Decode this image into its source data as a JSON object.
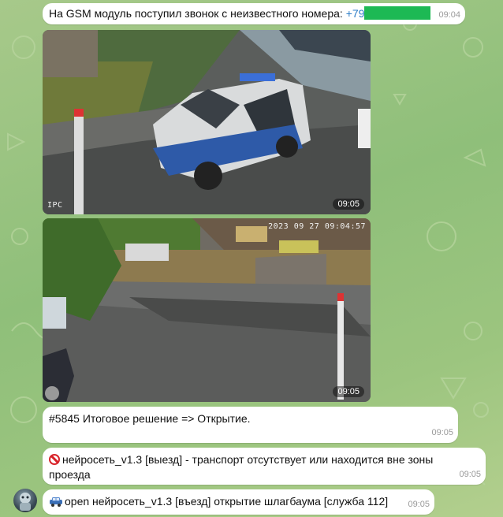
{
  "colors": {
    "bubble": "#ffffff",
    "link": "#2f7fc8",
    "masked_phone": "#1db954",
    "time": "#9a9a9a"
  },
  "messages": [
    {
      "text": "На GSM модуль поступил звонок с неизвестного номера: ",
      "phone_prefix": "+79",
      "time": "09:04"
    },
    {
      "time": "09:05",
      "camera_label": "IPC"
    },
    {
      "time": "09:05",
      "camera_stamp": "2023 09 27 09:04:57"
    },
    {
      "text": "#5845 Итоговое решение => Открытие.",
      "time": "09:05"
    },
    {
      "icon": "no-entry-icon",
      "text": "нейросеть_v1.3 [выезд] - транспорт отсутствует или находится вне зоны проезда",
      "time": "09:05"
    },
    {
      "icon": "car-icon",
      "text": "open нейросеть_v1.3 [въезд] открытие шлагбаума [служба 112]",
      "time": "09:05"
    }
  ]
}
